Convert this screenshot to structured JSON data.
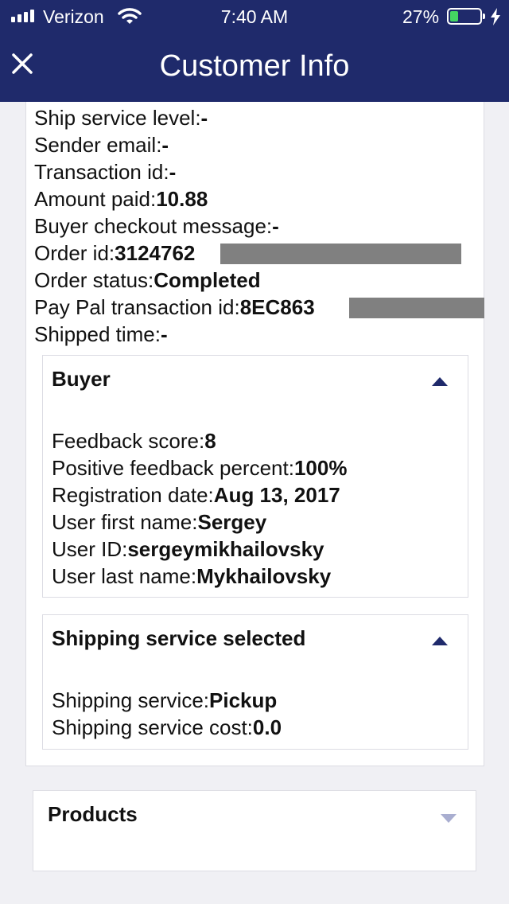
{
  "status_bar": {
    "carrier": "Verizon",
    "time": "7:40 AM",
    "battery": "27%",
    "battery_level": 0.27
  },
  "header": {
    "title": "Customer Info"
  },
  "order_fields": [
    {
      "label": "Ship service level:",
      "value": "-"
    },
    {
      "label": "Sender email:",
      "value": "-"
    },
    {
      "label": "Transaction id:",
      "value": "-"
    },
    {
      "label": "Amount paid:",
      "value": "10.88"
    },
    {
      "label": "Buyer checkout message:",
      "value": "-"
    },
    {
      "label": "Order id:",
      "value": "3124762"
    },
    {
      "label": "Order status:",
      "value": "Completed"
    },
    {
      "label": "Pay Pal transaction id:",
      "value": "8EC863"
    },
    {
      "label": "Shipped time:",
      "value": "-"
    }
  ],
  "buyer": {
    "title": "Buyer",
    "fields": [
      {
        "label": "Feedback score:",
        "value": "8"
      },
      {
        "label": "Positive feedback percent:",
        "value": "100%"
      },
      {
        "label": "Registration date:",
        "value": "Aug 13, 2017"
      },
      {
        "label": "User first name:",
        "value": "Sergey"
      },
      {
        "label": "User ID:",
        "value": "sergeymikhailovsky"
      },
      {
        "label": "User last name:",
        "value": "Mykhailovsky"
      }
    ]
  },
  "shipping": {
    "title": "Shipping service selected",
    "fields": [
      {
        "label": "Shipping service:",
        "value": "Pickup"
      },
      {
        "label": "Shipping service cost:",
        "value": "0.0"
      }
    ]
  },
  "products": {
    "title": "Products"
  },
  "colors": {
    "header_bg": "#1f2a6b",
    "battery": "#44d662",
    "redaction": "#808080"
  },
  "icons": {
    "close": "close-icon",
    "collapse": "chevron-up-icon",
    "expand": "chevron-down-icon"
  }
}
